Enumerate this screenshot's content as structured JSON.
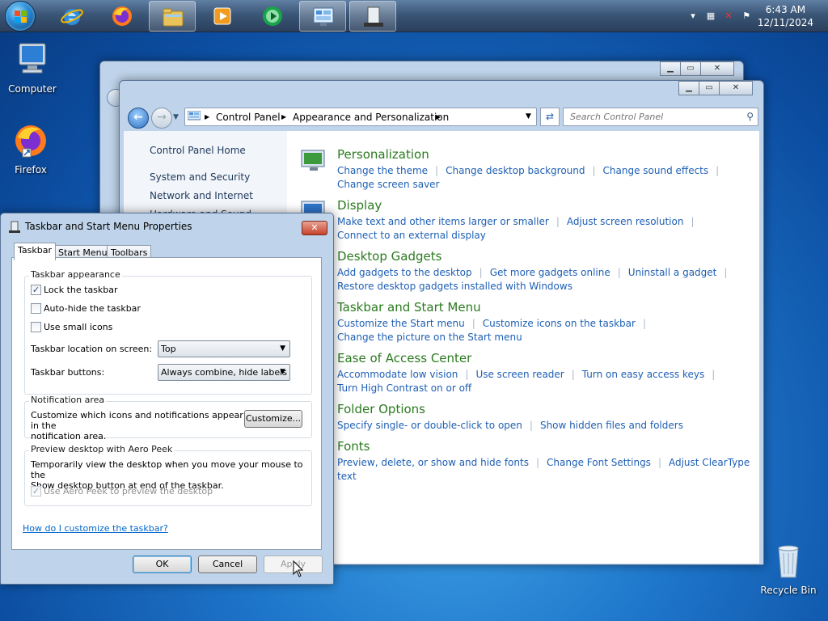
{
  "taskbar": {
    "clock_time": "6:43 AM",
    "clock_date": "12/11/2024",
    "buttons": [
      {
        "name": "start-button",
        "icon": "windows-logo-icon"
      },
      {
        "name": "internet-explorer",
        "icon": "internet-explorer-icon"
      },
      {
        "name": "firefox",
        "icon": "firefox-icon"
      },
      {
        "name": "file-explorer",
        "icon": "folder-icon"
      },
      {
        "name": "media-player",
        "icon": "media-player-icon"
      },
      {
        "name": "media-center",
        "icon": "media-center-icon"
      },
      {
        "name": "control-panel",
        "icon": "control-panel-icon"
      },
      {
        "name": "taskbar-properties",
        "icon": "taskbar-properties-icon"
      }
    ]
  },
  "desktop": {
    "icons": [
      {
        "label": "Computer"
      },
      {
        "label": "Firefox"
      },
      {
        "label": "Recycle Bin"
      }
    ]
  },
  "control_panel": {
    "breadcrumb": [
      "Control Panel",
      "Appearance and Personalization"
    ],
    "search_placeholder": "Search Control Panel",
    "sidebar": [
      "Control Panel Home",
      "System and Security",
      "Network and Internet",
      "Hardware and Sound"
    ],
    "sections": [
      {
        "title": "Personalization",
        "links": [
          "Change the theme",
          "Change desktop background",
          "Change sound effects",
          "Change screen saver"
        ],
        "accent": "#2a7a1e"
      },
      {
        "title": "Display",
        "links": [
          "Make text and other items larger or smaller",
          "Adjust screen resolution",
          "Connect to an external display"
        ]
      },
      {
        "title": "Desktop Gadgets",
        "links": [
          "Add gadgets to the desktop",
          "Get more gadgets online",
          "Uninstall a gadget",
          "Restore desktop gadgets installed with Windows"
        ]
      },
      {
        "title": "Taskbar and Start Menu",
        "links": [
          "Customize the Start menu",
          "Customize icons on the taskbar",
          "Change the picture on the Start menu"
        ]
      },
      {
        "title": "Ease of Access Center",
        "links": [
          "Accommodate low vision",
          "Use screen reader",
          "Turn on easy access keys",
          "Turn High Contrast on or off"
        ]
      },
      {
        "title": "Folder Options",
        "links": [
          "Specify single- or double-click to open",
          "Show hidden files and folders"
        ]
      },
      {
        "title": "Fonts",
        "links": [
          "Preview, delete, or show and hide fonts",
          "Change Font Settings",
          "Adjust ClearType text"
        ]
      }
    ]
  },
  "dialog": {
    "title": "Taskbar and Start Menu Properties",
    "tabs": [
      "Taskbar",
      "Start Menu",
      "Toolbars"
    ],
    "appearance": {
      "group_label": "Taskbar appearance",
      "lock": "Lock the taskbar",
      "autohide": "Auto-hide the taskbar",
      "small_icons": "Use small icons",
      "location_label": "Taskbar location on screen:",
      "location_value": "Top",
      "buttons_label": "Taskbar buttons:",
      "buttons_value": "Always combine, hide labels"
    },
    "notification": {
      "group_label": "Notification area",
      "text_line1": "Customize which icons and notifications appear in the",
      "text_line2": "notification area.",
      "customize": "Customize..."
    },
    "aero": {
      "group_label": "Preview desktop with Aero Peek",
      "text_line1": "Temporarily view the desktop when you move your mouse to the",
      "text_line2": "Show desktop button at end of the taskbar.",
      "checkbox": "Use Aero Peek to preview the desktop"
    },
    "help_link": "How do I customize the taskbar?",
    "ok": "OK",
    "cancel": "Cancel",
    "apply": "Apply"
  }
}
